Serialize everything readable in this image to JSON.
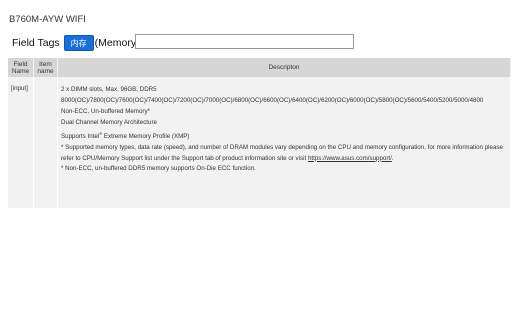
{
  "header": {
    "model_name": "B760M-AYW WIFI"
  },
  "tags": {
    "label": "Field Tags",
    "button_label": "内存",
    "tag_text": "(Memory)",
    "input_value": "",
    "input_placeholder": ""
  },
  "table": {
    "columns": {
      "field_name": "Field Name",
      "item_name": "Item name",
      "description": "Descripton"
    },
    "rows": [
      {
        "field_name": "[input]",
        "item_name": "",
        "description": {
          "line1": "2 x DIMM slots, Max. 96GB, DDR5",
          "line2": "8000(OC)/7800(OC)/7600(OC)/7400(OC)/7200(OC)/7000(OC)/6800(OC)/6600(OC)/6400(OC)/6200(OC)/6000(OC)/5800(OC)/5600/5400/5200/5000/4800",
          "line3": "Non-ECC, Un-buffered Memory*",
          "line4": "Dual Channel Memory Architecture",
          "line5_prefix": "Supports Intel",
          "line5_reg": "®",
          "line5_suffix": " Extreme Memory Profile (XMP)",
          "line6_part1": "* Supported memory types, data rate (speed), and number of DRAM modules vary depending on the CPU and memory configuration, for more information please refer to CPU/Memory Support list under the Support tab of product information site or visit ",
          "line6_link": "https://www.asus.com/support/",
          "line6_end": ".",
          "line7": "* Non-ECC, un-buffered DDR5 memory supports On-Die ECC function."
        }
      }
    ]
  }
}
